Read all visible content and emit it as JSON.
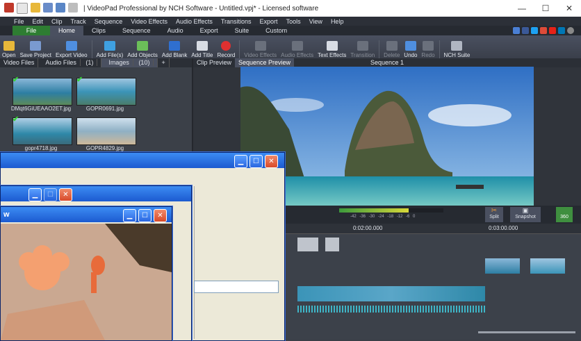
{
  "window": {
    "title": "| VideoPad Professional by NCH Software - Untitled.vpj* - Licensed software",
    "minimize": "—",
    "maximize": "☐",
    "close": "✕"
  },
  "menu": [
    "File",
    "Edit",
    "Clip",
    "Track",
    "Sequence",
    "Video Effects",
    "Audio Effects",
    "Transitions",
    "Export",
    "Tools",
    "View",
    "Help"
  ],
  "ribbon_tabs": [
    "File",
    "Home",
    "Clips",
    "Sequence",
    "Audio",
    "Export",
    "Suite",
    "Custom"
  ],
  "toolbar": [
    "Open",
    "Save Project",
    "Export Video",
    "Add File(s)",
    "Add Objects",
    "Add Blank",
    "Add Title",
    "Record",
    "Video Effects",
    "Audio Effects",
    "Text Effects",
    "Transition",
    "Delete",
    "Undo",
    "Redo",
    "NCH Suite"
  ],
  "media_tabs": [
    "Video Files",
    "Audio Files",
    "(1)",
    "Images",
    "(10)",
    "+"
  ],
  "media_items": [
    {
      "name": "DMqt6GiUEAAO2ET.jpg",
      "checked": true
    },
    {
      "name": "GOPR0691.jpg",
      "checked": true
    },
    {
      "name": "gopr4718.jpg",
      "checked": true
    },
    {
      "name": "GOPR4829.jpg",
      "checked": false
    }
  ],
  "preview_tabs": [
    "Clip Preview",
    "Sequence Preview"
  ],
  "sequence_title": "Sequence 1",
  "level_labels": "-42 -36 -30 -24 -18 -12 -6 0",
  "controls": {
    "split": "Split",
    "snapshot": "Snapshot",
    "vr": "360"
  },
  "timeline": {
    "t1": "0:02:00.000",
    "t2": "0:03:00.000"
  },
  "overlay": {
    "title_w": "w"
  },
  "colors": {
    "accent_green": "#2e7d32",
    "ui_dark": "#30343b",
    "xp_blue": "#1c5ad0"
  }
}
